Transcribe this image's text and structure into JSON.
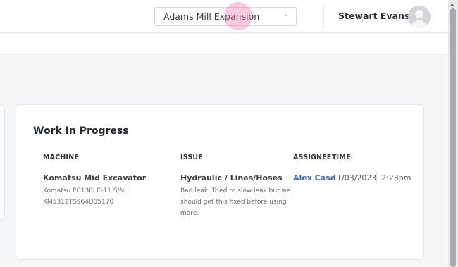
{
  "header": {
    "project_select": {
      "value": "Adams Mill Expansion"
    },
    "user": {
      "name": "Stewart Evans"
    }
  },
  "card": {
    "title": "Work In Progress",
    "columns": [
      "MACHINE",
      "ISSUE",
      "ASSIGNEE",
      "TIME"
    ],
    "rows": [
      {
        "machine_name": "Komatsu Mid Excavator",
        "machine_detail": [
          "Komatsu PC130LC-11 S/N:",
          "KM5312TS964U85170"
        ],
        "issue_title": "Hydraulic / Lines/Hoses",
        "issue_detail": [
          "Bad leak. Tried to slow leak but we",
          "should get this fixed before using",
          "more."
        ],
        "assignee": "Alex Case",
        "date": "11/03/2023",
        "time": "2:23pm"
      }
    ]
  },
  "colors": {
    "link": "#3b63c7",
    "background": "#f5f6f8",
    "cursor_highlight": "#ec70aa"
  }
}
